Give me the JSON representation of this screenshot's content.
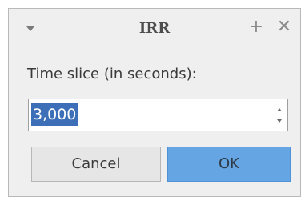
{
  "dialog": {
    "title": "IRR",
    "menu_icon": "chevron-down-icon",
    "titlebar_buttons": {
      "plus": "+",
      "close": "✕"
    }
  },
  "form": {
    "label": "Time slice (in seconds):",
    "spin_value": "3,000"
  },
  "buttons": {
    "cancel_label": "Cancel",
    "ok_label": "OK"
  },
  "colors": {
    "accent": "#66a5e3",
    "selection": "#3d6fb8",
    "background": "#efefef"
  }
}
